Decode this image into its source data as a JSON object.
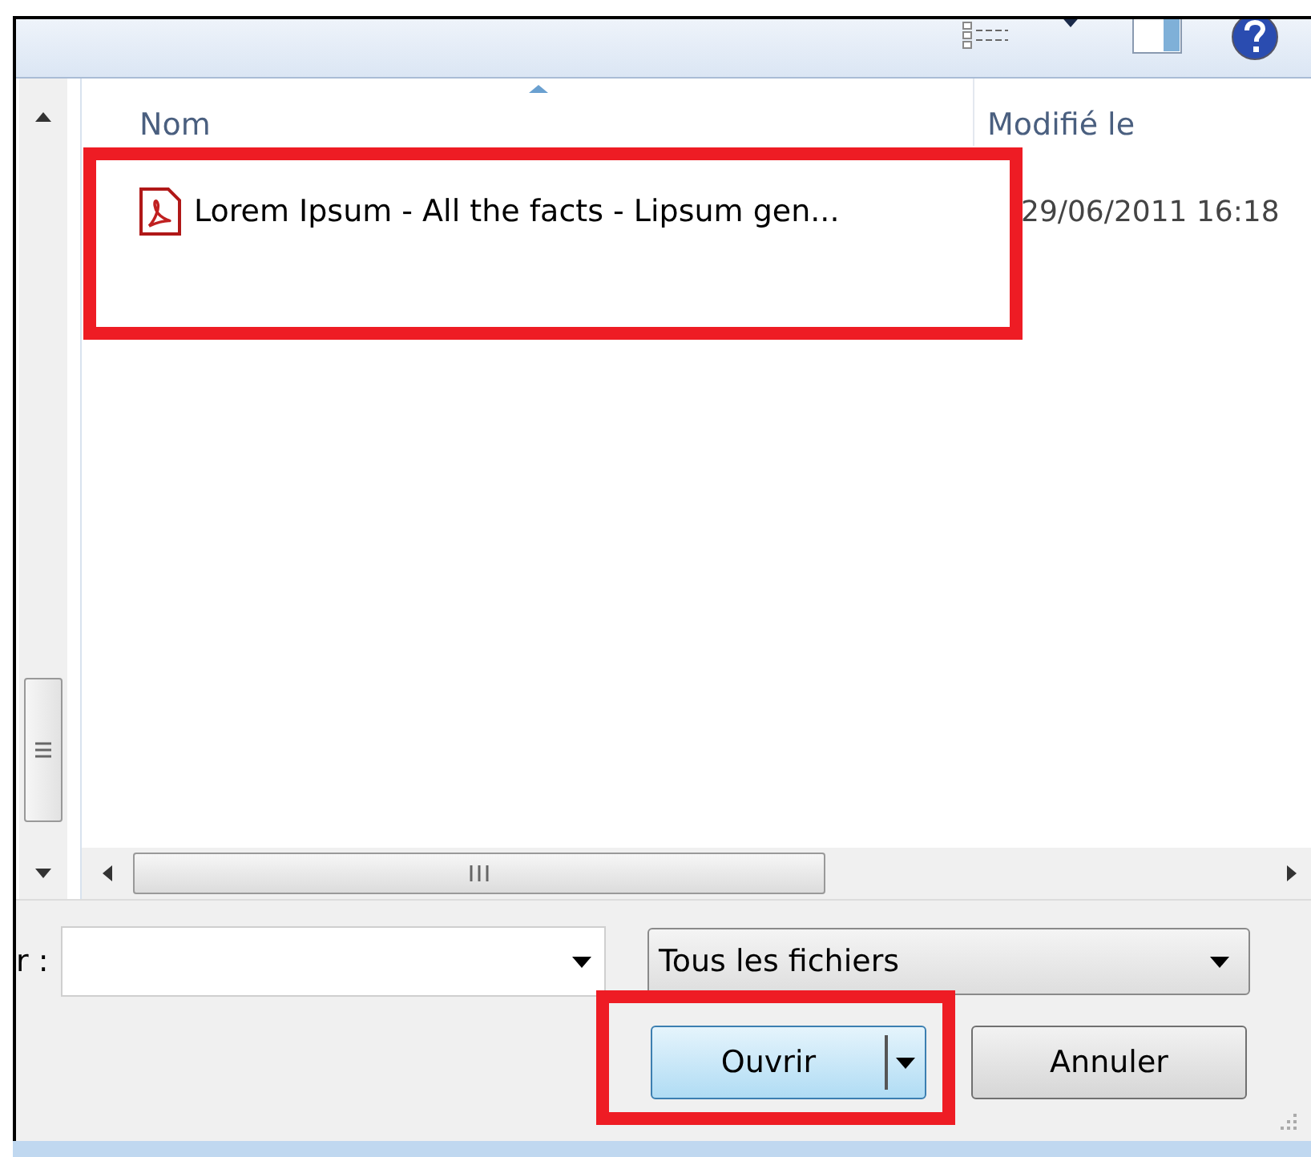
{
  "columns": [
    {
      "label": "Nom",
      "sorted": true
    },
    {
      "label": "Modifié le",
      "sorted": false
    }
  ],
  "files": [
    {
      "name": "Lorem Ipsum - All the facts - Lipsum gen...",
      "modified": "29/06/2011 16:18"
    }
  ],
  "filename_label": "r :",
  "filter": {
    "value": "Tous les fichiers"
  },
  "buttons": [
    {
      "label": "Ouvrir",
      "kind": "split",
      "default": true
    },
    {
      "label": "Annuler",
      "kind": "plain",
      "default": false
    }
  ]
}
